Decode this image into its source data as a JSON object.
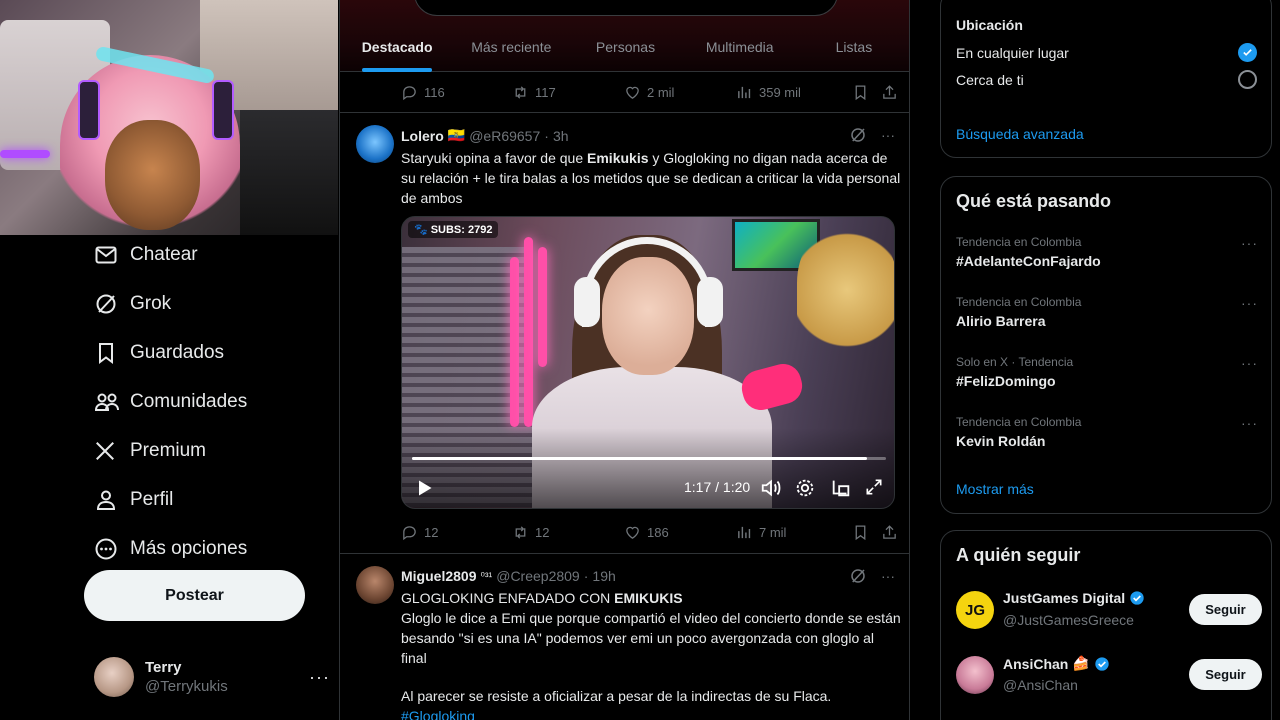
{
  "nav": {
    "items": [
      {
        "label": "Chatear",
        "icon": "envelope-icon"
      },
      {
        "label": "Grok",
        "icon": "grok-icon"
      },
      {
        "label": "Guardados",
        "icon": "bookmark-icon"
      },
      {
        "label": "Comunidades",
        "icon": "people-icon"
      },
      {
        "label": "Premium",
        "icon": "x-logo-icon"
      },
      {
        "label": "Perfil",
        "icon": "person-icon"
      },
      {
        "label": "Más opciones",
        "icon": "more-circle-icon"
      }
    ],
    "post_label": "Postear"
  },
  "account": {
    "name": "Terry",
    "handle": "@Terrykukis",
    "more": "···"
  },
  "tabs": [
    {
      "label": "Destacado",
      "active": true
    },
    {
      "label": "Más reciente"
    },
    {
      "label": "Personas"
    },
    {
      "label": "Multimedia"
    },
    {
      "label": "Listas"
    }
  ],
  "prev_tweet_actions": {
    "replies": "116",
    "reposts": "117",
    "likes": "2 mil",
    "views": "359 mil"
  },
  "tweet1": {
    "name": "Lolero",
    "flag": "🇪🇨",
    "handle": "@eR69657",
    "dot": "·",
    "time": "3h",
    "text_a": "Staryuki opina a favor de que ",
    "text_b": "Emikukis",
    "text_c": " y Glogloking no digan nada acerca de su relación + le tira balas a los metidos que se dedican a criticar la vida personal de ambos",
    "video": {
      "subs": "SUBS: 2792",
      "time": "1:17 / 1:20",
      "progress": 0.96
    },
    "actions": {
      "replies": "12",
      "reposts": "12",
      "likes": "186",
      "views": "7 mil"
    }
  },
  "tweet2": {
    "name": "Miguel2809",
    "badge": "⁰³¹",
    "handle": "@Creep2809",
    "dot": "·",
    "time": "19h",
    "line1_a": "GLOGLOKING ENFADADO CON ",
    "line1_b": "EMIKUKIS",
    "para": "Gloglo le dice a Emi que porque compartió el video del concierto donde se están besando \"si es una IA\"  podemos ver emi un poco avergonzada con gloglo al final",
    "para2": "Al parecer  se resiste a oficializar a pesar de la indirectas de su Flaca.",
    "hashtag": "#Glogloking"
  },
  "location": {
    "title": "Ubicación",
    "options": [
      {
        "label": "En cualquier lugar",
        "selected": true
      },
      {
        "label": "Cerca de ti",
        "selected": false
      }
    ],
    "advanced": "Búsqueda avanzada"
  },
  "trends": {
    "title": "Qué está pasando",
    "items": [
      {
        "context": "Tendencia en Colombia",
        "topic": "#AdelanteConFajardo"
      },
      {
        "context": "Tendencia en Colombia",
        "topic": "Alirio Barrera"
      },
      {
        "context": "Solo en X · Tendencia",
        "topic": "#FelizDomingo"
      },
      {
        "context": "Tendencia en Colombia",
        "topic": "Kevin Roldán"
      }
    ],
    "dots": "···",
    "more": "Mostrar más"
  },
  "follow": {
    "title": "A quién seguir",
    "items": [
      {
        "name": "JustGames Digital",
        "handle": "@JustGamesGreece",
        "button": "Seguir"
      },
      {
        "name": "AnsiChan",
        "emoji": "🍰",
        "handle": "@AnsiChan",
        "button": "Seguir"
      }
    ]
  },
  "colors": {
    "accent": "#1d9bf0",
    "bg": "#000000",
    "border": "#2f3336",
    "muted": "#71767b"
  }
}
